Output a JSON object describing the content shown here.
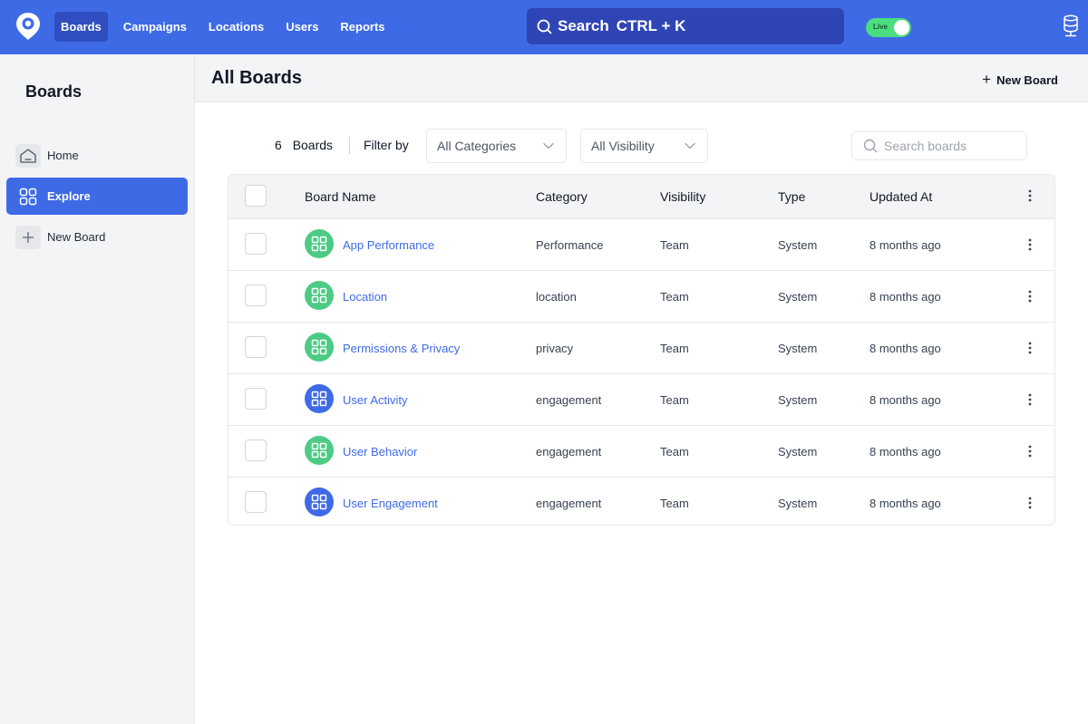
{
  "topbar": {
    "nav": [
      "Boards",
      "Campaigns",
      "Locations",
      "Users",
      "Reports"
    ],
    "search_label": "Search",
    "search_shortcut": "CTRL + K",
    "live_label": "Live",
    "accent": "#3f6ae6"
  },
  "sidebar": {
    "title": "Boards",
    "items": [
      {
        "label": "Home",
        "icon": "home-icon"
      },
      {
        "label": "Explore",
        "icon": "grid-icon"
      },
      {
        "label": "New Board",
        "icon": "plus-icon"
      }
    ]
  },
  "header": {
    "title": "All Boards",
    "new_board": "New Board"
  },
  "toolbar": {
    "count": "6",
    "count_label": "Boards",
    "filter_by": "Filter by",
    "category_select": "All Categories",
    "visibility_select": "All Visibility",
    "search_placeholder": "Search boards"
  },
  "table": {
    "columns": [
      "Board Name",
      "Category",
      "Visibility",
      "Type",
      "Updated At"
    ],
    "rows": [
      {
        "name": "App Performance",
        "category": "Performance",
        "visibility": "Team",
        "type": "System",
        "updated": "8 months ago",
        "icon_color": "#4ccb84"
      },
      {
        "name": "Location",
        "category": "location",
        "visibility": "Team",
        "type": "System",
        "updated": "8 months ago",
        "icon_color": "#4ccb84"
      },
      {
        "name": "Permissions & Privacy",
        "category": "privacy",
        "visibility": "Team",
        "type": "System",
        "updated": "8 months ago",
        "icon_color": "#4ccb84"
      },
      {
        "name": "User Activity",
        "category": "engagement",
        "visibility": "Team",
        "type": "System",
        "updated": "8 months ago",
        "icon_color": "#3f6ae6"
      },
      {
        "name": "User Behavior",
        "category": "engagement",
        "visibility": "Team",
        "type": "System",
        "updated": "8 months ago",
        "icon_color": "#4ccb84"
      },
      {
        "name": "User Engagement",
        "category": "engagement",
        "visibility": "Team",
        "type": "System",
        "updated": "8 months ago",
        "icon_color": "#3f6ae6"
      }
    ]
  }
}
